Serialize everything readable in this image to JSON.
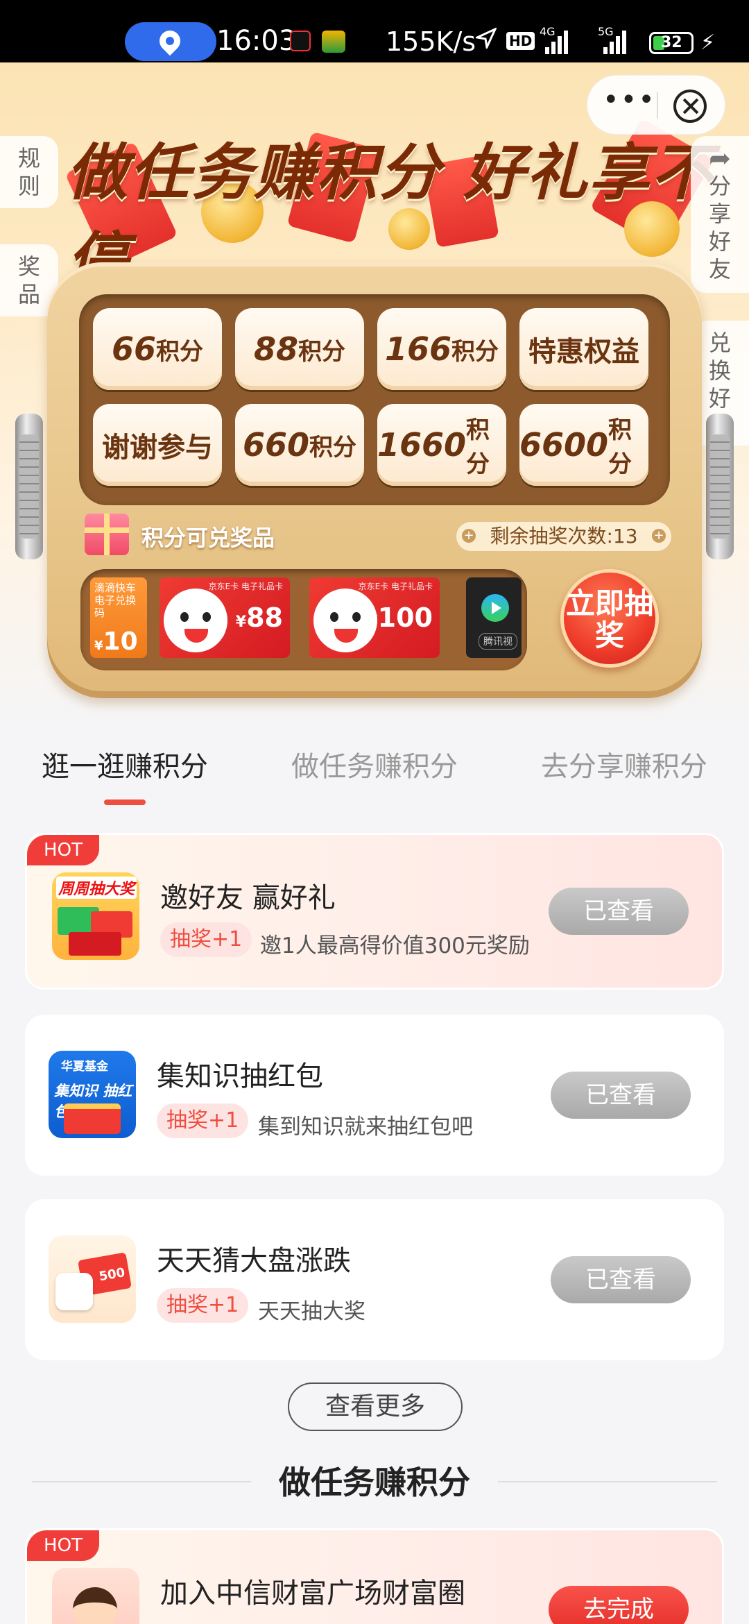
{
  "status_bar": {
    "time": "16:03",
    "speed": "155K/s",
    "hd": "HD",
    "net1": "4G",
    "net2": "5G",
    "battery": "32"
  },
  "hero": {
    "headline": "做任务赚积分 好礼享不停",
    "side_left": [
      "规则",
      "奖品"
    ],
    "side_right": [
      "分享好友",
      "兑换好礼"
    ],
    "tiles": [
      {
        "num": "66",
        "unit": "积分"
      },
      {
        "num": "88",
        "unit": "积分"
      },
      {
        "num": "166",
        "unit": "积分"
      },
      {
        "text": "特惠权益"
      },
      {
        "text": "谢谢参与"
      },
      {
        "num": "660",
        "unit": "积分"
      },
      {
        "num": "1660",
        "unit": "积分"
      },
      {
        "num": "6600",
        "unit": "积分"
      }
    ],
    "prize_label": "积分可兑奖品",
    "remaining": "剩余抽奖次数:13",
    "draw_button": "立即抽奖",
    "prizes": {
      "didi_line1": "滴滴快车",
      "didi_line2": "电子兑换码",
      "didi_value": "10",
      "jd_header": "京东E卡 电子礼品卡",
      "jd1_value": "88",
      "jd2_value": "100",
      "tencent_label": "腾讯视",
      "currency": "¥"
    }
  },
  "tabs": [
    "逛一逛赚积分",
    "做任务赚积分",
    "去分享赚积分"
  ],
  "tasks": [
    {
      "hot": "HOT",
      "title": "邀好友 赢好礼",
      "tag": "抽奖+1",
      "desc": "邀1人最高得价值300元奖励",
      "button": "已查看",
      "icon_text": "周周抽大奖"
    },
    {
      "title": "集知识抽红包",
      "tag": "抽奖+1",
      "desc": "集到知识就来抽红包吧",
      "button": "已查看",
      "icon_text1": "华夏基金",
      "icon_text2": "集知识 抽红包"
    },
    {
      "title": "天天猜大盘涨跌",
      "tag": "抽奖+1",
      "desc": "天天抽大奖",
      "button": "已查看",
      "icon_value": "500"
    }
  ],
  "more_button": "查看更多",
  "section_title": "做任务赚积分",
  "task_next": {
    "hot": "HOT",
    "title": "加入中信财富广场财富圈",
    "button": "去完成"
  }
}
